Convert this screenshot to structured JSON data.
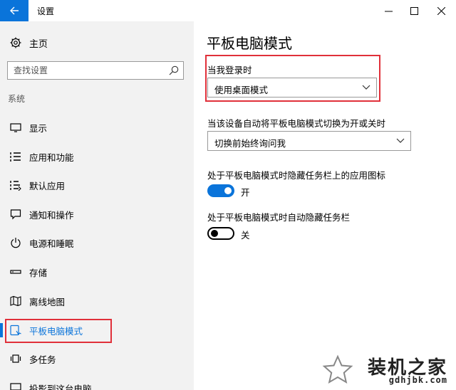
{
  "window": {
    "title": "设置",
    "controls": [
      "minimize",
      "maximize",
      "close"
    ]
  },
  "sidebar": {
    "home_label": "主页",
    "search_placeholder": "查找设置",
    "section_label": "系统",
    "items": [
      {
        "label": "显示",
        "icon": "display-icon"
      },
      {
        "label": "应用和功能",
        "icon": "apps-list-icon"
      },
      {
        "label": "默认应用",
        "icon": "default-apps-icon"
      },
      {
        "label": "通知和操作",
        "icon": "notification-icon"
      },
      {
        "label": "电源和睡眠",
        "icon": "power-icon"
      },
      {
        "label": "存储",
        "icon": "storage-icon"
      },
      {
        "label": "离线地图",
        "icon": "map-icon"
      },
      {
        "label": "平板电脑模式",
        "icon": "tablet-mode-icon",
        "active": true
      },
      {
        "label": "多任务",
        "icon": "multitask-icon"
      },
      {
        "label": "投影到这台电脑",
        "icon": "project-icon"
      }
    ]
  },
  "main": {
    "title": "平板电脑模式",
    "signin_label": "当我登录时",
    "signin_value": "使用桌面模式",
    "switch_label": "当该设备自动将平板电脑模式切换为开或关时",
    "switch_value": "切换前始终询问我",
    "hide_icons_label": "处于平板电脑模式时隐藏任务栏上的应用图标",
    "hide_icons_state": "开",
    "hide_icons_on": true,
    "hide_taskbar_label": "处于平板电脑模式时自动隐藏任务栏",
    "hide_taskbar_state": "关",
    "hide_taskbar_on": false
  },
  "watermark": {
    "text": "装机之家",
    "url": "gdhjbk.com"
  },
  "colors": {
    "accent": "#0a74da",
    "highlight_box": "#e0303a",
    "sidebar_bg": "#f2f2f2"
  }
}
